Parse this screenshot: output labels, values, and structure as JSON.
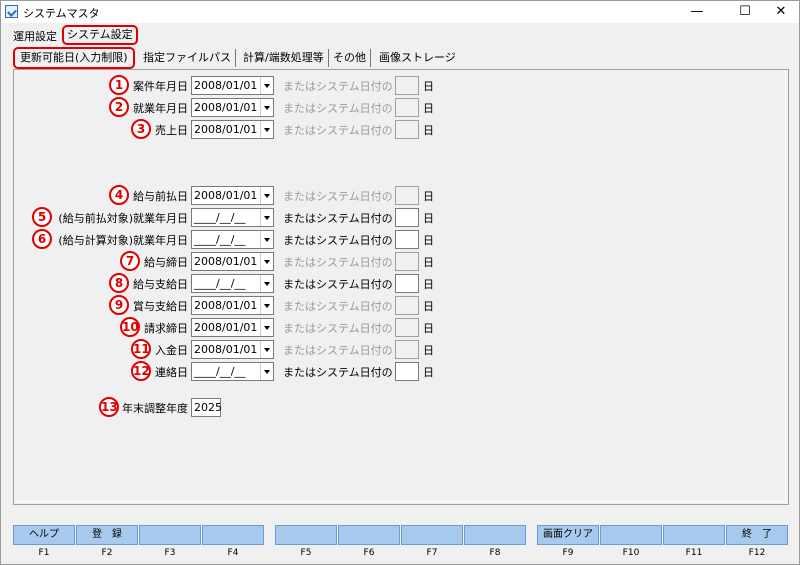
{
  "window": {
    "title": "システムマスタ",
    "minimize": "—",
    "maximize": "☐",
    "close": "✕"
  },
  "menu": {
    "items": [
      {
        "label": "運用設定"
      },
      {
        "label": "システム設定"
      }
    ]
  },
  "tabs": [
    {
      "label": "更新可能日(入力制限)"
    },
    {
      "label": "指定ファイルパス"
    },
    {
      "label": "計算/端数処理等"
    },
    {
      "label": "その他"
    },
    {
      "label": "画像ストレージ"
    }
  ],
  "rows": [
    {
      "num": "1",
      "label": "案件年月日",
      "date": "2008/01/01",
      "sys_text": "またはシステム日付の",
      "day": "日",
      "enabled": false
    },
    {
      "num": "2",
      "label": "就業年月日",
      "date": "2008/01/01",
      "sys_text": "またはシステム日付の",
      "day": "日",
      "enabled": false
    },
    {
      "num": "3",
      "label": "売上日",
      "date": "2008/01/01",
      "sys_text": "またはシステム日付の",
      "day": "日",
      "enabled": false
    },
    {
      "num": "4",
      "label": "給与前払日",
      "date": "2008/01/01",
      "sys_text": "またはシステム日付の",
      "day": "日",
      "enabled": false
    },
    {
      "num": "5",
      "label": "(給与前払対象)就業年月日",
      "date": "____/__/__",
      "sys_text": "またはシステム日付の",
      "day": "日",
      "enabled": true
    },
    {
      "num": "6",
      "label": "(給与計算対象)就業年月日",
      "date": "____/__/__",
      "sys_text": "またはシステム日付の",
      "day": "日",
      "enabled": true
    },
    {
      "num": "7",
      "label": "給与締日",
      "date": "2008/01/01",
      "sys_text": "またはシステム日付の",
      "day": "日",
      "enabled": false
    },
    {
      "num": "8",
      "label": "給与支給日",
      "date": "____/__/__",
      "sys_text": "またはシステム日付の",
      "day": "日",
      "enabled": true
    },
    {
      "num": "9",
      "label": "賞与支給日",
      "date": "2008/01/01",
      "sys_text": "またはシステム日付の",
      "day": "日",
      "enabled": false
    },
    {
      "num": "10",
      "label": "請求締日",
      "date": "2008/01/01",
      "sys_text": "またはシステム日付の",
      "day": "日",
      "enabled": false
    },
    {
      "num": "11",
      "label": "入金日",
      "date": "2008/01/01",
      "sys_text": "またはシステム日付の",
      "day": "日",
      "enabled": false
    },
    {
      "num": "12",
      "label": "連絡日",
      "date": "____/__/__",
      "sys_text": "またはシステム日付の",
      "day": "日",
      "enabled": true
    }
  ],
  "year_row": {
    "num": "13",
    "label": "年末調整年度",
    "value": "2025"
  },
  "fkeys": [
    {
      "label": "ヘルプ",
      "key": "F1"
    },
    {
      "label": "登　録",
      "key": "F2"
    },
    {
      "label": "",
      "key": "F3"
    },
    {
      "label": "",
      "key": "F4"
    },
    {
      "label": "",
      "key": "F5"
    },
    {
      "label": "",
      "key": "F6"
    },
    {
      "label": "",
      "key": "F7"
    },
    {
      "label": "",
      "key": "F8"
    },
    {
      "label": "画面クリア",
      "key": "F9"
    },
    {
      "label": "",
      "key": "F10"
    },
    {
      "label": "",
      "key": "F11"
    },
    {
      "label": "終　了",
      "key": "F12"
    }
  ],
  "colors": {
    "highlight": "#e00000",
    "fkey_bg": "#a7c9ee"
  }
}
